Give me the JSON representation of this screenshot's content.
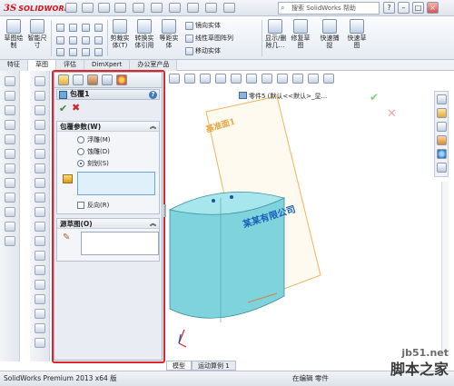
{
  "app": {
    "brand_ds": "3S",
    "brand_name": "SOLIDWORKS",
    "search_placeholder": "搜索 SolidWorks 帮助"
  },
  "ribbon": {
    "big_buttons": [
      {
        "label": "草图绘\n制"
      },
      {
        "label": "智能尺\n寸"
      },
      {
        "label": "剪裁实\n体(T)"
      },
      {
        "label": "转换实\n体引用"
      },
      {
        "label": "等距实\n体"
      },
      {
        "label": "显示/删\n除几…"
      },
      {
        "label": "修复草\n图"
      },
      {
        "label": "快速捕\n捉"
      },
      {
        "label": "快速草\n图"
      }
    ],
    "small_items": [
      {
        "label": "镜向实体"
      },
      {
        "label": "线性草图阵列"
      },
      {
        "label": "移动实体"
      }
    ]
  },
  "tabs": [
    "特征",
    "草图",
    "评估",
    "DimXpert",
    "办公室产品"
  ],
  "property_manager": {
    "title": "包覆1",
    "help": "?",
    "ok_symbol": "✔",
    "cancel_symbol": "✖",
    "params_group": {
      "title": "包覆参数(W)",
      "collapse": "︽",
      "options": [
        {
          "label": "浮雕(M)",
          "selected": false
        },
        {
          "label": "蚀雕(D)",
          "selected": false
        },
        {
          "label": "刻划(S)",
          "selected": true
        }
      ],
      "reverse_label": "反向(R)"
    },
    "source_group": {
      "title": "源草图(O)",
      "collapse": "︽"
    }
  },
  "viewport": {
    "crumb": "零件5 (默认<<默认>_显...",
    "plane_label": "基准面1",
    "company_text": "某某有限公司"
  },
  "model_tabs": [
    "模型",
    "运动算例 1"
  ],
  "status": {
    "left": "SolidWorks Premium 2013 x64 版",
    "right": "在编辑 零件"
  },
  "watermark": {
    "site": "jb51.net",
    "name": "脚本之家"
  }
}
